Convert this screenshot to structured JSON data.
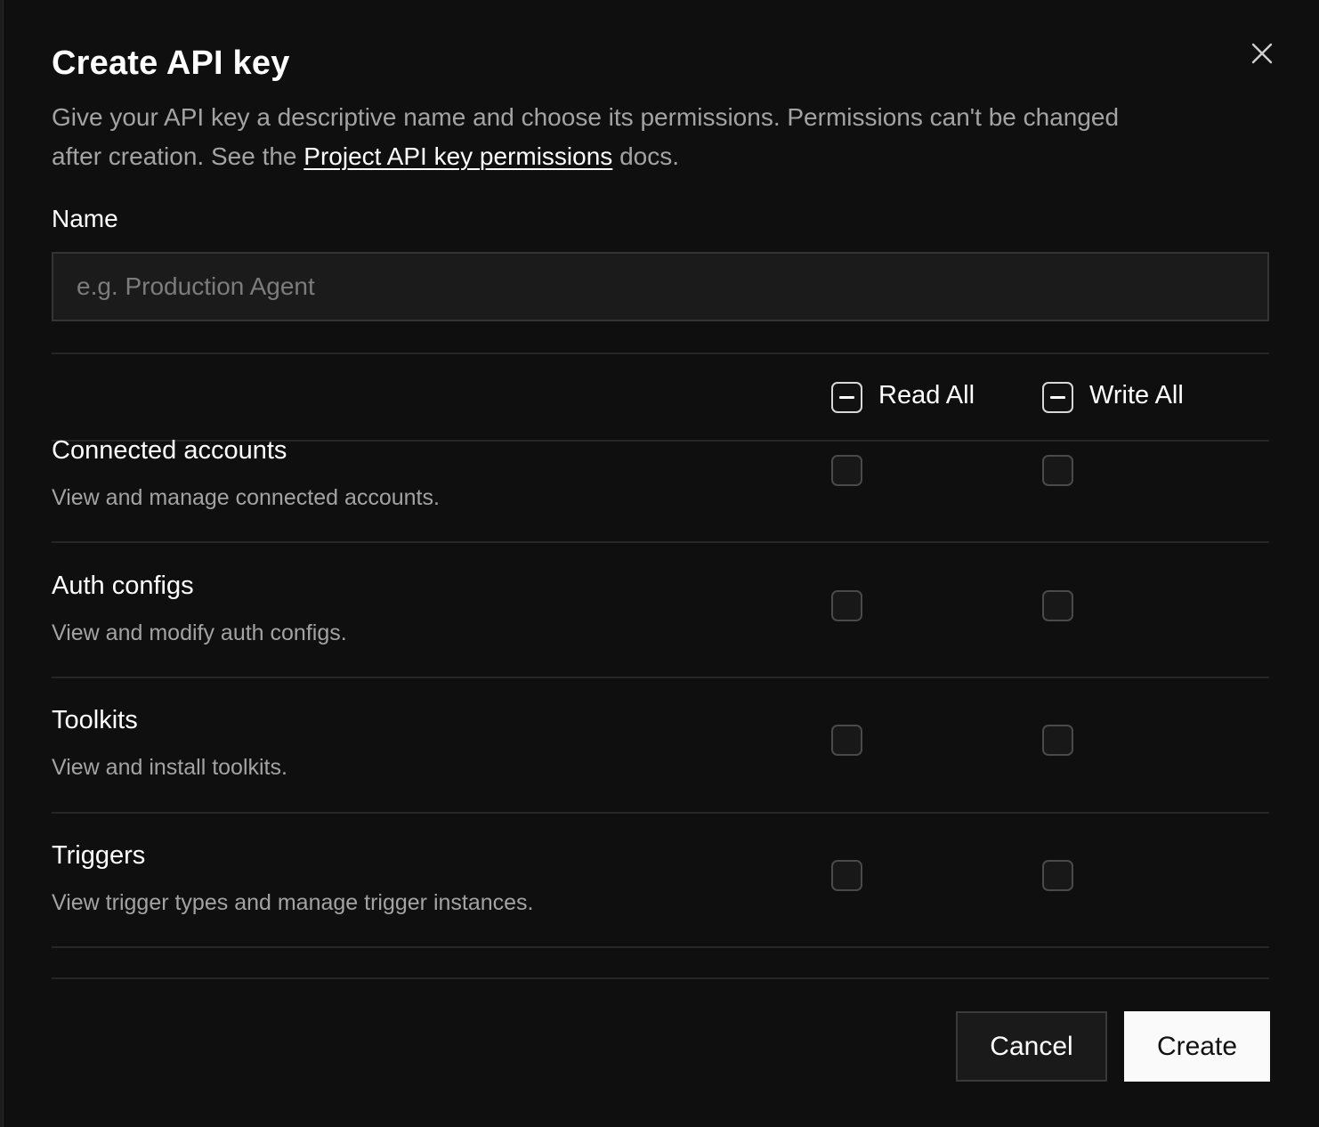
{
  "dialog": {
    "title": "Create API key",
    "description_before_link": "Give your API key a descriptive name and choose its permissions. Permissions can't be changed after creation. See the ",
    "link_text": "Project API key permissions",
    "description_after_link": " docs.",
    "close_icon": "close-icon"
  },
  "name_field": {
    "label": "Name",
    "placeholder": "e.g. Production Agent",
    "value": ""
  },
  "permissions": {
    "read_all_label": "Read All",
    "write_all_label": "Write All",
    "read_all_state": "indeterminate",
    "write_all_state": "indeterminate",
    "items": [
      {
        "title": "Connected accounts",
        "description": "View and manage connected accounts.",
        "read": false,
        "write": false
      },
      {
        "title": "Auth configs",
        "description": "View and modify auth configs.",
        "read": false,
        "write": false
      },
      {
        "title": "Toolkits",
        "description": "View and install toolkits.",
        "read": false,
        "write": false
      },
      {
        "title": "Triggers",
        "description": "View trigger types and manage trigger instances.",
        "read": false,
        "write": false
      }
    ]
  },
  "footer": {
    "cancel_label": "Cancel",
    "create_label": "Create"
  }
}
